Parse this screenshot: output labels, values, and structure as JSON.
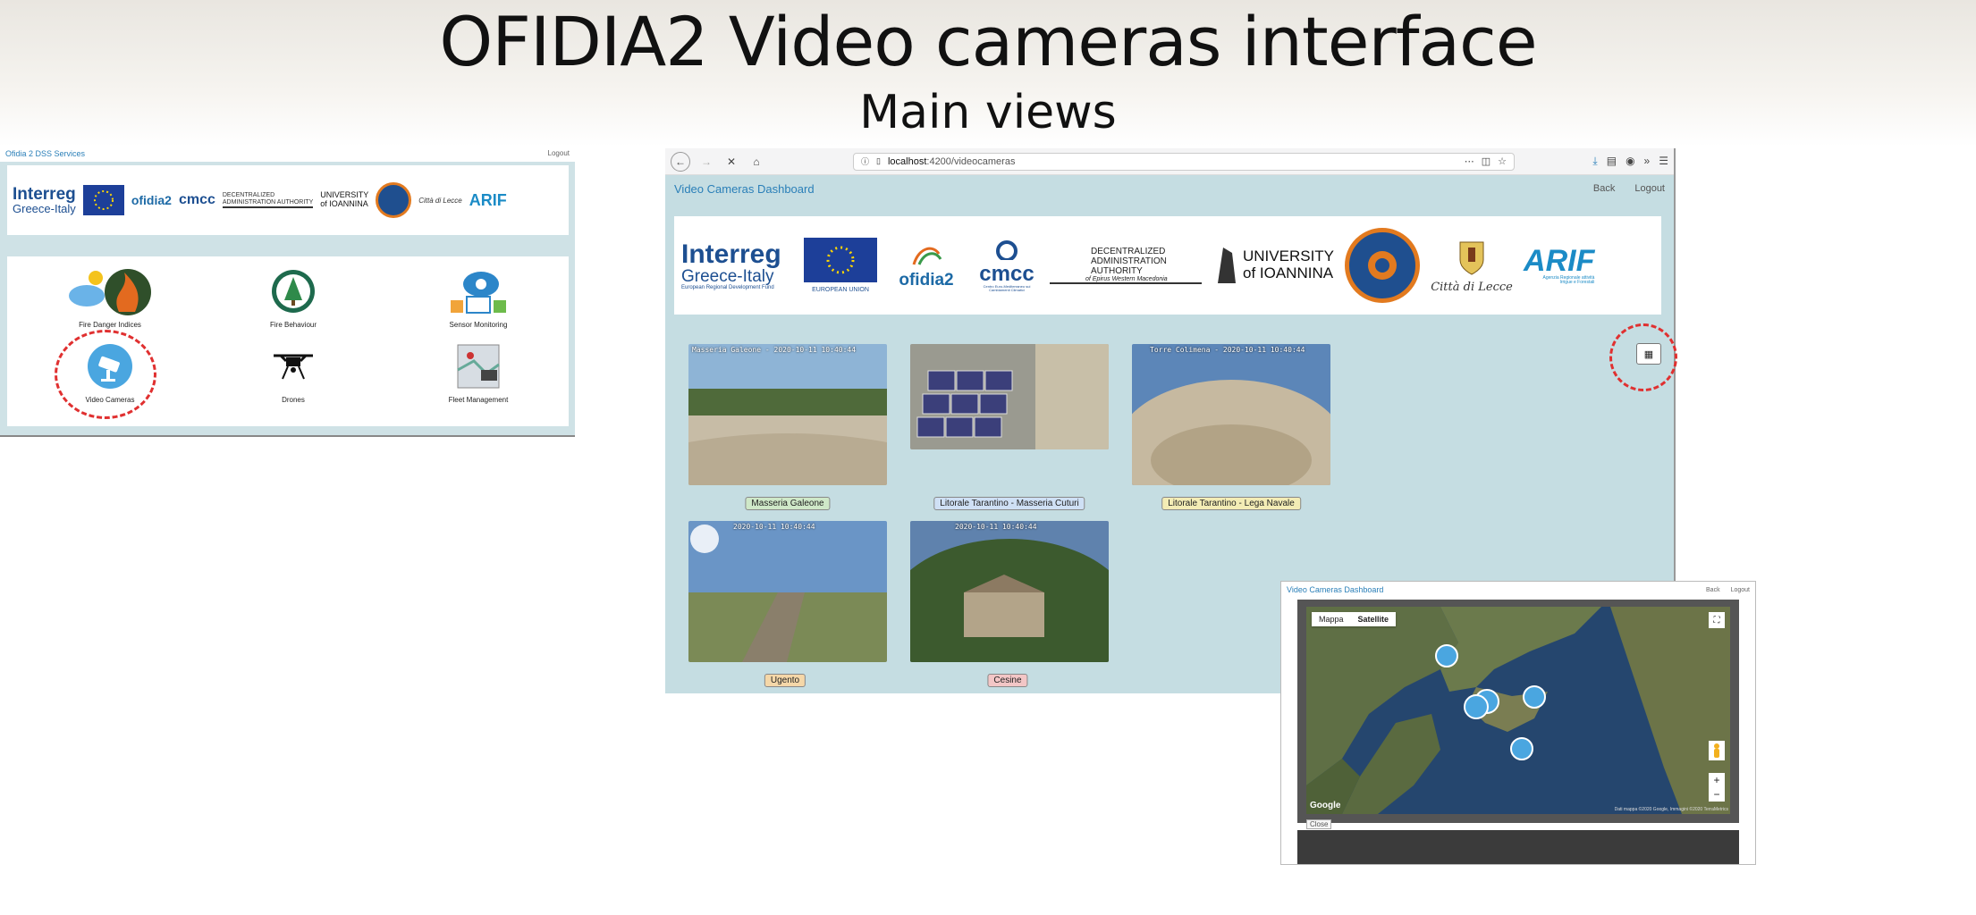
{
  "slide": {
    "title": "OFIDIA2 Video cameras interface",
    "subtitle": "Main views"
  },
  "left_app": {
    "title": "Ofidia 2 DSS Services",
    "logout": "Logout",
    "tiles": [
      {
        "label": "Fire Danger Indices",
        "icon": "fire-danger-icon"
      },
      {
        "label": "Fire Behaviour",
        "icon": "tree-icon"
      },
      {
        "label": "Sensor Monitoring",
        "icon": "sensor-cloud-icon"
      },
      {
        "label": "Video Cameras",
        "icon": "camera-icon"
      },
      {
        "label": "Drones",
        "icon": "drone-icon"
      },
      {
        "label": "Fleet Management",
        "icon": "fleet-map-icon"
      }
    ]
  },
  "browser": {
    "url_host": "localhost",
    "url_path": ":4200/videocameras",
    "brand": "Video Cameras Dashboard",
    "back": "Back",
    "logout": "Logout"
  },
  "logos": {
    "interreg": "Interreg",
    "greece_italy": "Greece-Italy",
    "erdf": "European Regional Development Fund",
    "eu": "EUROPEAN UNION",
    "ofidia": "ofidia2",
    "cmcc": "cmcc",
    "cmcc_sub": "Centro Euro-Mediterraneo sui Cambiamenti Climatici",
    "decentralized_1": "DECENTRALIZED",
    "decentralized_2": "ADMINISTRATION AUTHORITY",
    "epirus": "of Epirus Western Macedonia",
    "university": "UNIVERSITY",
    "ioannina": "of IOANNINA",
    "lecce": "Città di Lecce",
    "arif": "ARIF",
    "arif_sub": "Agenzia Regionale attività Irrigue e Forestali"
  },
  "cameras": [
    {
      "label": "Masseria Galeone",
      "stamp": "Masseria Galeone - 2020-10-11 10:40:44",
      "color": "#cfe8c8"
    },
    {
      "label": "Litorale Tarantino - Masseria Cuturi",
      "stamp": "",
      "color": "#cfe0f5"
    },
    {
      "label": "Litorale Tarantino - Lega Navale",
      "stamp": "Torre Colimena - 2020-10-11 10:40:44",
      "color": "#f3ecb5"
    },
    {
      "label": "Ugento",
      "stamp": "2020-10-11 10:40:44",
      "color": "#f5d7a8"
    },
    {
      "label": "Cesine",
      "stamp": "2020-10-11 10:40:44",
      "color": "#f3c6c6"
    }
  ],
  "map_popup": {
    "title": "Video Cameras Dashboard",
    "back": "Back",
    "logout": "Logout",
    "tab_map": "Mappa",
    "tab_satellite": "Satellite",
    "google": "Google",
    "attribution": "Dati mappa ©2020 Google, Immagini ©2020 TerraMetrics",
    "close": "Close",
    "zoom_in": "+",
    "zoom_out": "−",
    "fullscreen": "⛶"
  },
  "colors": {
    "accent": "#2a7fb8",
    "dashboard_bg": "#c5dde2",
    "highlight": "#e03030",
    "marker": "#4aa6e0"
  }
}
